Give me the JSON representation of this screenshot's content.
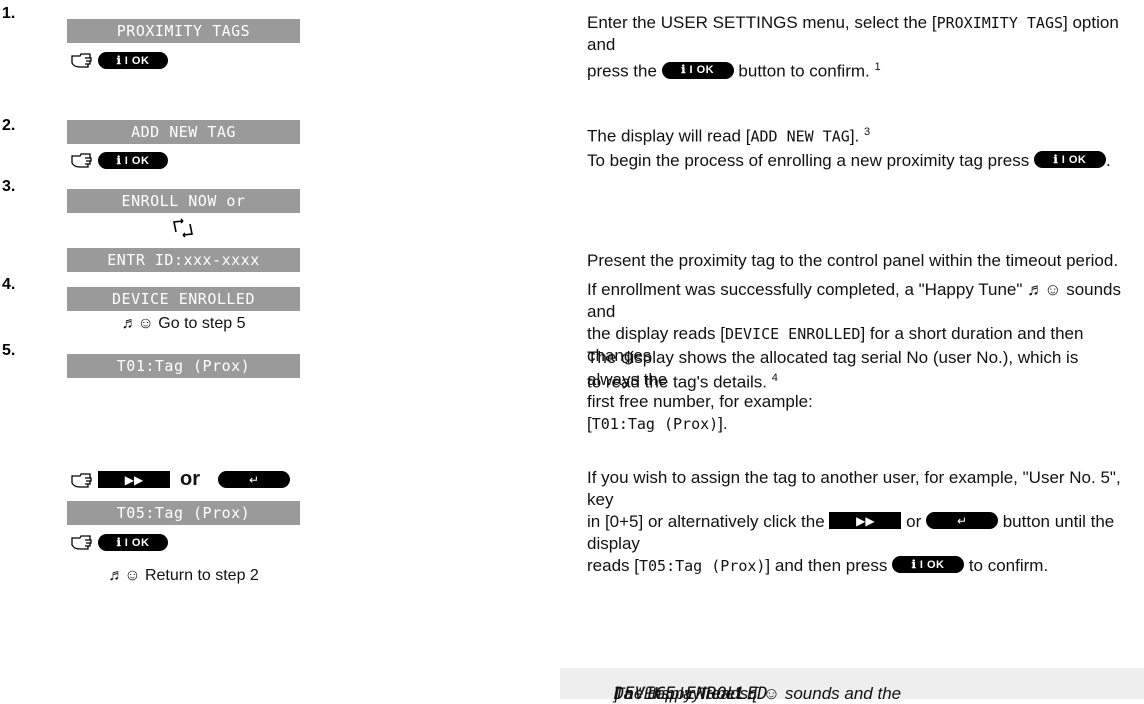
{
  "steps": {
    "s1": {
      "num": "1.",
      "lcd": "PROXIMITY TAGS",
      "t1": "Enter the USER SETTINGS menu, select the [",
      "t1mono": "PROXIMITY TAGS",
      "t1b": "] option and",
      "t2": "press the",
      "t2b": "button to confirm.",
      "sup": "1"
    },
    "s2": {
      "num": "2.",
      "lcd": "ADD NEW TAG",
      "t1": "The display will read [",
      "t1mono": "ADD NEW TAG",
      "t1b": "].",
      "sup": "3",
      "t2": "To begin the process of enrolling a new proximity tag press",
      "t2b": "."
    },
    "s3": {
      "num": "3.",
      "lcd": "ENROLL NOW or",
      "lcd2": "ENTR ID:xxx-xxxx",
      "t1": "Present the proximity tag to the control panel within the timeout period."
    },
    "s4": {
      "num": "4.",
      "lcd": "DEVICE ENROLLED",
      "caption": "♬☺ Go to step 5",
      "t1": "If enrollment was successfully completed, a \"Happy Tune\" ♬☺ sounds and",
      "t2a": "the display reads [",
      "t2mono": "DEVICE ENROLLED",
      "t2b": "] for a short duration and then changes",
      "t3": "to read the tag's details.",
      "sup": "4"
    },
    "s5": {
      "num": "5.",
      "lcd": "T01:Tag (Prox)",
      "t1": "The display shows the allocated tag serial No (user No.), which is always the",
      "t2": "first free number, for example:",
      "t3a": "[",
      "t3mono": "T01:Tag (Prox)",
      "t3b": "]."
    },
    "s6": {
      "lcd": "T05:Tag (Prox)",
      "or": "or",
      "caption": "♬☺ Return to step 2",
      "t1": "If you wish to assign the tag to another user, for example, \"User No. 5\", key",
      "t2a": "in [0+5] or alternatively click the",
      "t2or": "or",
      "t2b": "button until the display",
      "t3a": "reads [",
      "t3mono": "T05:Tag (Prox)",
      "t3b": "] and then press",
      "t3c": "to confirm."
    }
  },
  "ok_label": "ℹ I OK",
  "next_glyph": "▶▶",
  "back_glyph": "↵",
  "note": {
    "prefix": "The display reads [",
    "mono": "DEVICE ENROLLED",
    "suffix": "] a \"Happy Tune\" ♬☺ sounds and the"
  }
}
